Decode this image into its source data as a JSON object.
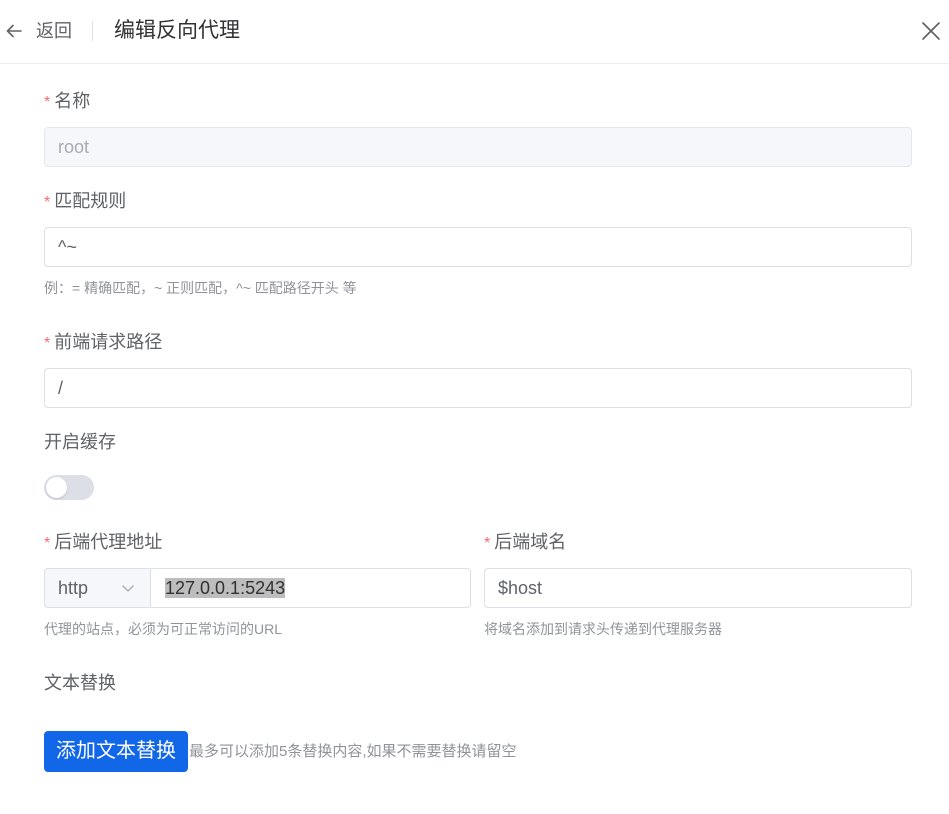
{
  "header": {
    "back_label": "返回",
    "title": "编辑反向代理"
  },
  "form": {
    "name": {
      "label": "名称",
      "value": "root",
      "required": true,
      "disabled": true
    },
    "match_rule": {
      "label": "匹配规则",
      "value": "^~",
      "required": true,
      "help": "例：= 精确匹配，~ 正则匹配，^~ 匹配路径开头 等"
    },
    "frontend_path": {
      "label": "前端请求路径",
      "value": "/",
      "required": true
    },
    "cache": {
      "label": "开启缓存",
      "enabled": false
    },
    "backend_address": {
      "label": "后端代理地址",
      "required": true,
      "scheme": "http",
      "value": "127.0.0.1:5243",
      "help": "代理的站点，必须为可正常访问的URL"
    },
    "backend_host": {
      "label": "后端域名",
      "required": true,
      "value": "$host",
      "help": "将域名添加到请求头传递到代理服务器"
    },
    "text_replace": {
      "label": "文本替换",
      "button_label": "添加文本替换",
      "hint": "最多可以添加5条替换内容,如果不需要替换请留空"
    }
  },
  "colors": {
    "primary": "#1267e8",
    "required_mark": "#f56c6c",
    "help_text": "#909399",
    "border": "#dcdfe6"
  },
  "icons": {
    "back": "arrow-left-icon",
    "close": "close-icon",
    "select": "chevron-down-icon"
  }
}
